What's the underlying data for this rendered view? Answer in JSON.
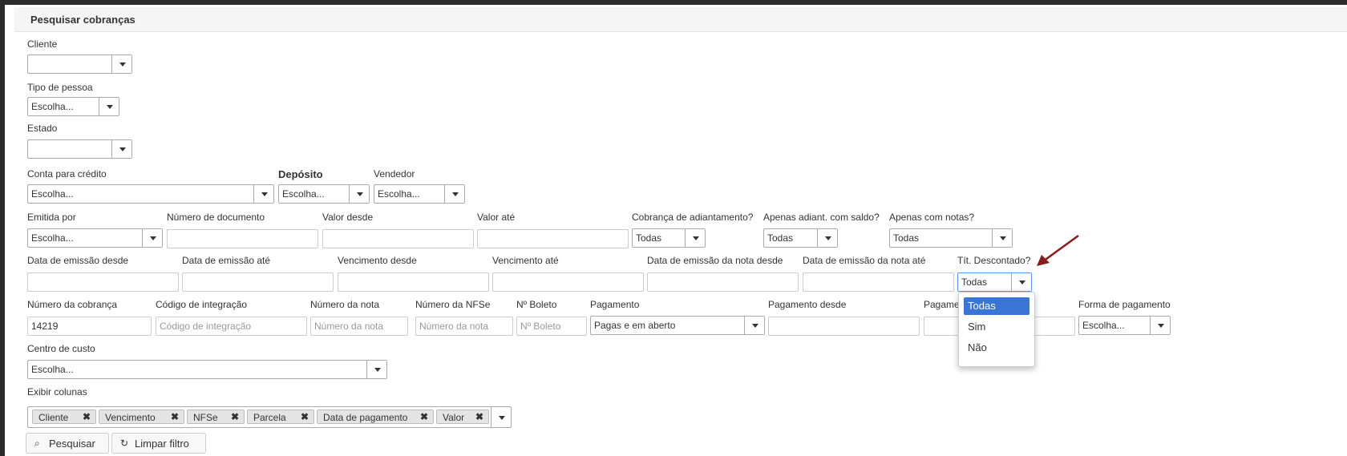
{
  "title": "Pesquisar cobranças",
  "fields": {
    "cliente": {
      "label": "Cliente",
      "value": ""
    },
    "tipo_pessoa": {
      "label": "Tipo de pessoa",
      "value": "Escolha..."
    },
    "estado": {
      "label": "Estado",
      "value": ""
    },
    "conta_credito": {
      "label": "Conta para crédito",
      "value": "Escolha..."
    },
    "deposito": {
      "label": "Depósito",
      "value": "Escolha..."
    },
    "vendedor": {
      "label": "Vendedor",
      "value": "Escolha..."
    },
    "emitida_por": {
      "label": "Emitida por",
      "value": "Escolha..."
    },
    "numero_documento": {
      "label": "Número de documento",
      "value": ""
    },
    "valor_desde": {
      "label": "Valor desde",
      "value": ""
    },
    "valor_ate": {
      "label": "Valor até",
      "value": ""
    },
    "cobranca_adiantamento": {
      "label": "Cobrança de adiantamento?",
      "value": "Todas"
    },
    "apenas_adiant_saldo": {
      "label": "Apenas adiant. com saldo?",
      "value": "Todas"
    },
    "apenas_notas": {
      "label": "Apenas com notas?",
      "value": "Todas"
    },
    "data_emissao_desde": {
      "label": "Data de emissão desde",
      "value": ""
    },
    "data_emissao_ate": {
      "label": "Data de emissão até",
      "value": ""
    },
    "vencimento_desde": {
      "label": "Vencimento desde",
      "value": ""
    },
    "vencimento_ate": {
      "label": "Vencimento até",
      "value": ""
    },
    "data_emissao_nota_desde": {
      "label": "Data de emissão da nota desde",
      "value": ""
    },
    "data_emissao_nota_ate": {
      "label": "Data de emissão da nota até",
      "value": ""
    },
    "tit_descontado": {
      "label": "Tít. Descontado?",
      "value": "Todas"
    },
    "numero_cobranca": {
      "label": "Número da cobrança",
      "value": "14219"
    },
    "codigo_integracao": {
      "label": "Código de integração",
      "placeholder": "Código de integração"
    },
    "numero_nota": {
      "label": "Número da nota",
      "placeholder": "Número da nota"
    },
    "numero_nfse": {
      "label": "Número da NFSe",
      "placeholder": "Número da nota"
    },
    "n_boleto": {
      "label": "Nº Boleto",
      "placeholder": "Nº Boleto"
    },
    "pagamento": {
      "label": "Pagamento",
      "value": "Pagas e em aberto"
    },
    "pagamento_desde": {
      "label": "Pagamento desde",
      "value": ""
    },
    "pagamento_ate": {
      "label": "Pagame",
      "value": ""
    },
    "forma_pagamento": {
      "label": "Forma de pagamento",
      "value": "Escolha..."
    },
    "centro_custo": {
      "label": "Centro de custo",
      "value": "Escolha..."
    },
    "exibir_colunas": {
      "label": "Exibir colunas"
    }
  },
  "columns_tags": [
    "Cliente",
    "Vencimento",
    "NFSe",
    "Parcela",
    "Data de pagamento",
    "Valor"
  ],
  "tag_remove": "✖",
  "dropdown_options": [
    "Todas",
    "Sim",
    "Não"
  ],
  "buttons": {
    "search": "Pesquisar",
    "search_icon": "⌕",
    "clear": "Limpar filtro",
    "clear_icon": "↻"
  },
  "colors": {
    "highlight": "#3875d7",
    "arrow": "#8b1a1a"
  }
}
